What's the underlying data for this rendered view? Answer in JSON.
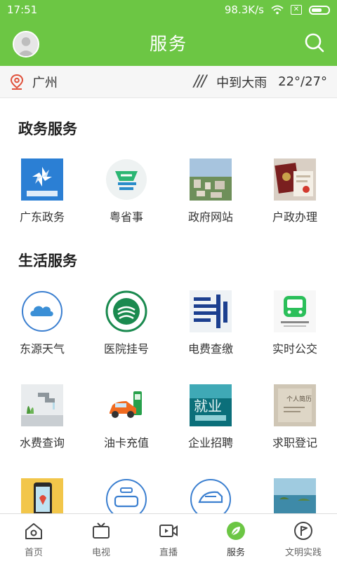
{
  "status_bar": {
    "time": "17:51",
    "network_speed": "98.3K/s"
  },
  "header": {
    "title": "服务"
  },
  "location": {
    "city": "广州",
    "weather": "中到大雨",
    "temperature": "22°/27°"
  },
  "gov_section": {
    "title": "政务服务",
    "items": [
      {
        "label": "广东政务",
        "icon": "guangdong-gov-icon"
      },
      {
        "label": "粤省事",
        "icon": "yueshengshi-icon"
      },
      {
        "label": "政府网站",
        "icon": "gov-website-icon"
      },
      {
        "label": "户政办理",
        "icon": "household-registration-icon"
      }
    ]
  },
  "life_section": {
    "title": "生活服务",
    "items": [
      {
        "label": "东源天气",
        "icon": "weather-cloud-icon"
      },
      {
        "label": "医院挂号",
        "icon": "hospital-icon"
      },
      {
        "label": "电费查缴",
        "icon": "power-grid-icon"
      },
      {
        "label": "实时公交",
        "icon": "bus-icon"
      },
      {
        "label": "水费查询",
        "icon": "water-faucet-icon"
      },
      {
        "label": "油卡充值",
        "icon": "fuel-car-icon"
      },
      {
        "label": "企业招聘",
        "icon": "recruitment-icon"
      },
      {
        "label": "求职登记",
        "icon": "job-registration-icon"
      },
      {
        "label": "",
        "icon": "phone-map-icon"
      },
      {
        "label": "",
        "icon": "car-icon"
      },
      {
        "label": "",
        "icon": "train-icon"
      },
      {
        "label": "",
        "icon": "scenery-icon"
      }
    ]
  },
  "tabbar": {
    "items": [
      {
        "label": "首页",
        "icon": "home-icon"
      },
      {
        "label": "电视",
        "icon": "tv-icon"
      },
      {
        "label": "直播",
        "icon": "live-icon"
      },
      {
        "label": "服务",
        "icon": "service-leaf-icon",
        "active": true
      },
      {
        "label": "文明实践",
        "icon": "flag-icon"
      }
    ]
  },
  "colors": {
    "brand_green": "#6cc644",
    "accent_blue": "#3b7fd0",
    "location_red": "#e0503a"
  }
}
